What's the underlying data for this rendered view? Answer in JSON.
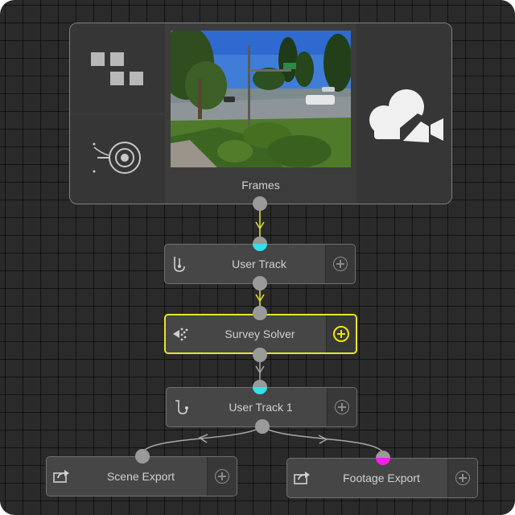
{
  "source_node": {
    "frames_label": "Frames",
    "icons": [
      "tiles-icon",
      "lens-icon",
      "movie-camera-icon"
    ],
    "thumbnail_name": "frames-thumbnail"
  },
  "nodes": {
    "user_track": {
      "label": "User Track",
      "icon": "track-icon"
    },
    "survey_solver": {
      "label": "Survey Solver",
      "icon": "solver-icon",
      "selected": true
    },
    "user_track_1": {
      "label": "User Track 1",
      "icon": "track-icon"
    },
    "scene_export": {
      "label": "Scene Export",
      "icon": "export-icon"
    },
    "footage_export": {
      "label": "Footage Export",
      "icon": "export-icon"
    }
  },
  "colors": {
    "active_wire": "#e6e62a",
    "wire": "#a8a8a8",
    "port_cyan": "#33e0ee",
    "port_magenta": "#ee22ee",
    "selected_border": "#e6e62a"
  }
}
